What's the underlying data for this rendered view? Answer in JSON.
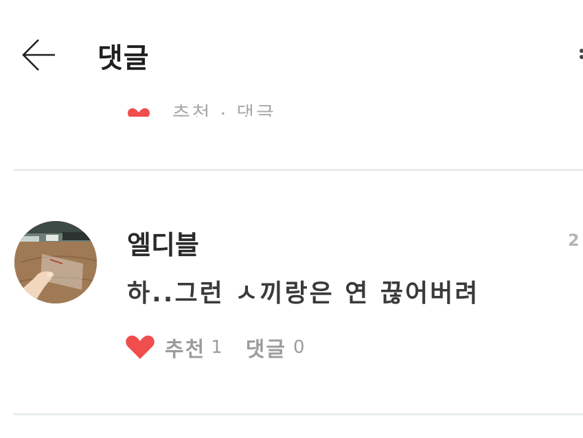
{
  "header": {
    "title": "댓글",
    "back_icon": "arrow-left-icon",
    "more_icon": "more-vertical-icon"
  },
  "previous_comment": {
    "actions_text": "추천 · 댓글"
  },
  "comment": {
    "author": "엘디블",
    "timestamp": "2",
    "text": "하..그런 ㅅ끼랑은 연 끊어버려",
    "like_label": "추천",
    "like_count": "1",
    "reply_label": "댓글",
    "reply_count": "0"
  },
  "colors": {
    "heart": "#f04e4e",
    "divider": "#e6ecea",
    "muted_text": "#9c9c9c",
    "primary_text": "#2a2a2a"
  }
}
